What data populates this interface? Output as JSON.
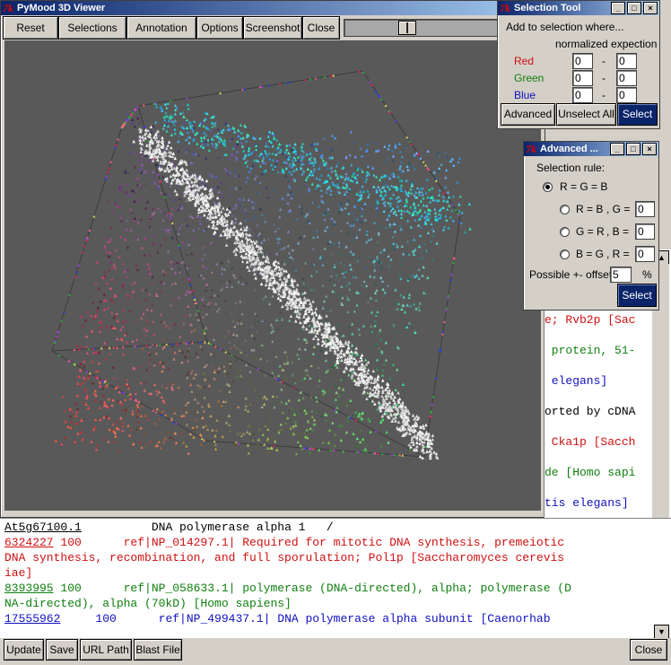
{
  "viewer": {
    "title": "PyMood 3D Viewer",
    "toolbar": [
      "Reset",
      "Selections",
      "Annotation",
      "Options",
      "Screenshot",
      "Close"
    ],
    "slider_value": 0.4
  },
  "selection_tool": {
    "title": "Selection Tool",
    "prompt": "Add to selection where...",
    "subtitle": "normalized expection",
    "rows": [
      {
        "label": "Red",
        "color": "#d01010",
        "from": "0",
        "to": "0"
      },
      {
        "label": "Green",
        "color": "#108010",
        "from": "0",
        "to": "0"
      },
      {
        "label": "Blue",
        "color": "#1010c0",
        "from": "0",
        "to": "0"
      }
    ],
    "dash": "-",
    "buttons": {
      "advanced": "Advanced",
      "unselect_all": "Unselect All",
      "select": "Select"
    }
  },
  "advanced": {
    "title": "Advanced ...",
    "rule_label": "Selection rule:",
    "rules": [
      {
        "label": "R = G = B",
        "selected": true,
        "extra": "",
        "value": ""
      },
      {
        "label": "R = B",
        "selected": false,
        "extra": ", G =",
        "value": "0"
      },
      {
        "label": "G = R",
        "selected": false,
        "extra": ", B =",
        "value": "0"
      },
      {
        "label": "B = G",
        "selected": false,
        "extra": ", R =",
        "value": "0"
      }
    ],
    "offset_label": "Possible +- offset:",
    "offset_value": "5",
    "percent": "%",
    "select": "Select"
  },
  "right_panel_lines": [
    {
      "text": "e; Rvb2p [Sac",
      "color": "red"
    },
    {
      "text": " protein, 51-",
      "color": "green"
    },
    {
      "text": " elegans]",
      "color": "blue"
    },
    {
      "text": "orted by cDNA",
      "color": "black"
    },
    {
      "text": " Cka1p [Sacch",
      "color": "red"
    },
    {
      "text": "de [Homo sapi",
      "color": "green"
    },
    {
      "text": "tis elegans]",
      "color": "blue"
    }
  ],
  "text_lines": [
    {
      "segments": [
        {
          "text": "At5g67100.1",
          "color": "black",
          "ul": true
        },
        {
          "text": "          DNA polymerase alpha 1   /",
          "color": "black",
          "ul": false
        }
      ]
    },
    {
      "segments": [
        {
          "text": "6324227",
          "color": "red",
          "ul": true
        },
        {
          "text": " 100      ref|NP_014297.1| Required for mitotic DNA synthesis, premeiotic",
          "color": "red",
          "ul": false
        }
      ]
    },
    {
      "segments": [
        {
          "text": "DNA synthesis, recombination, and full sporulation; Pol1p [Saccharomyces cerevis",
          "color": "red",
          "ul": false
        }
      ]
    },
    {
      "segments": [
        {
          "text": "iae]",
          "color": "red",
          "ul": false
        }
      ]
    },
    {
      "segments": [
        {
          "text": "8393995",
          "color": "green",
          "ul": true
        },
        {
          "text": " 100      ref|NP_058633.1| polymerase (DNA-directed), alpha; polymerase (D",
          "color": "green",
          "ul": false
        }
      ]
    },
    {
      "segments": [
        {
          "text": "NA-directed), alpha (70kD) [Homo sapiens]",
          "color": "green",
          "ul": false
        }
      ]
    },
    {
      "segments": [
        {
          "text": "17555962",
          "color": "blue",
          "ul": true
        },
        {
          "text": "     100      ref|NP_499437.1| DNA polymerase alpha subunit [Caenorhab",
          "color": "blue",
          "ul": false
        }
      ]
    }
  ],
  "bottom_buttons": [
    "Update",
    "Save",
    "URL Path",
    "Blast File"
  ],
  "close_label": "Close",
  "tk_glyph": "7k",
  "wbtn_glyphs": [
    "_",
    "□",
    "×"
  ]
}
